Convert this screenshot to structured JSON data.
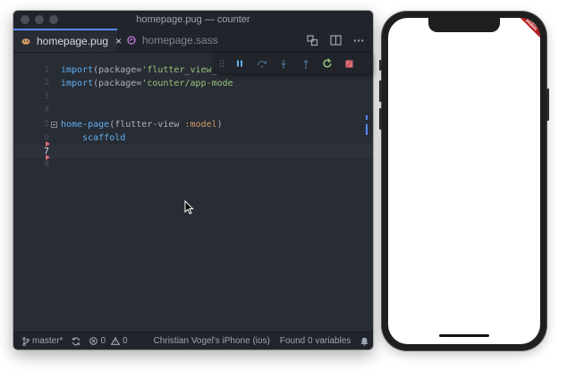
{
  "window": {
    "title": "homepage.pug — counter"
  },
  "tabs": [
    {
      "label": "homepage.pug",
      "close": "×",
      "icon": "pug-file-icon"
    },
    {
      "label": "homepage.sass",
      "icon": "sass-file-icon"
    }
  ],
  "toolbar": {
    "icons": [
      "copy-tree-icon",
      "split-pane-icon",
      "more-icon"
    ],
    "more_label": "···"
  },
  "editor": {
    "line_numbers": [
      "1",
      "2",
      "3",
      "4",
      "5",
      "6",
      "7",
      "8"
    ],
    "current_line": "7",
    "lines": [
      {
        "kw": "import",
        "pre": "(package=",
        "str": "'flutter_view_to",
        "post": ""
      },
      {
        "kw": "import",
        "pre": "(package=",
        "str": "'counter/app-mode",
        "post": ""
      },
      {
        "text": ""
      },
      {
        "text": ""
      },
      {
        "fn": "home-page",
        "pre": "(flutter-view ",
        "atom": ":model",
        "post": ")"
      },
      {
        "indent": "    ",
        "text": "scaffold"
      },
      {
        "text": ""
      },
      {
        "text": ""
      }
    ]
  },
  "debug_toolbar": {
    "buttons": [
      "pause-icon",
      "step-over-icon",
      "step-into-icon",
      "step-out-icon",
      "hot-reload-icon",
      "stop-icon"
    ],
    "colors": {
      "default": "#61afef",
      "reload": "#98c379",
      "stop": "#e06c75"
    }
  },
  "statusbar": {
    "branch": "master*",
    "errors": "0",
    "warnings": "0",
    "device": "Christian Vogel's iPhone (ios)",
    "variables": "Found 0 variables"
  },
  "phone": {
    "banner": "DEBUG"
  }
}
